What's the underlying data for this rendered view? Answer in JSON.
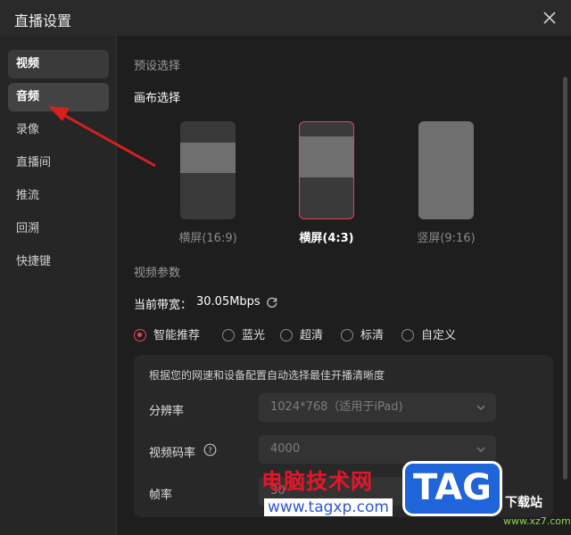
{
  "window": {
    "title": "直播设置"
  },
  "sidebar": {
    "items": [
      {
        "label": "视频"
      },
      {
        "label": "音频"
      },
      {
        "label": "录像"
      },
      {
        "label": "直播间"
      },
      {
        "label": "推流"
      },
      {
        "label": "回溯"
      },
      {
        "label": "快捷键"
      }
    ]
  },
  "preset": {
    "section_title": "预设选择",
    "canvas_title": "画布选择",
    "options": [
      {
        "label": "横屏(16:9)"
      },
      {
        "label": "横屏(4:3)"
      },
      {
        "label": "竖屏(9:16)"
      }
    ],
    "selected": "横屏(4:3)"
  },
  "video": {
    "section_title": "视频参数",
    "bandwidth_label": "当前带宽：",
    "bandwidth_value": "30.05Mbps",
    "quality_options": [
      {
        "label": "智能推荐"
      },
      {
        "label": "蓝光"
      },
      {
        "label": "超清"
      },
      {
        "label": "标清"
      },
      {
        "label": "自定义"
      }
    ],
    "selected_quality": "智能推荐",
    "hint": "根据您的网速和设备配置自动选择最佳开播清晰度",
    "resolution_label": "分辨率",
    "resolution_value": "1024*768（适用于iPad)",
    "bitrate_label": "视频码率",
    "bitrate_value": "4000",
    "framerate_label": "帧率",
    "framerate_value": "30"
  },
  "watermark": {
    "site_name": "电脑技术网",
    "site_url": "www.tagxp.com",
    "logo_text": "TAG",
    "corner_text": "下载站",
    "corner_url": "www.xz7.com"
  },
  "colors": {
    "accent": "#e8435a",
    "bg": "#1e1e1e",
    "sidebar": "#262626",
    "arrow": "#d42020"
  }
}
